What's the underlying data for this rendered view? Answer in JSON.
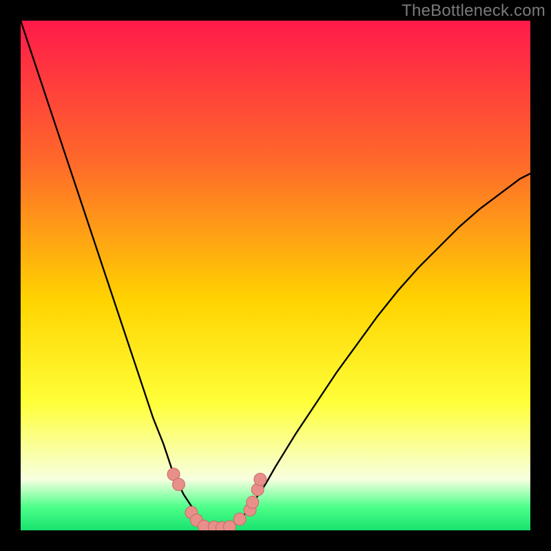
{
  "watermark": "TheBottleneck.com",
  "colors": {
    "bg_black": "#000000",
    "grad_top": "#ff1a4a",
    "grad_mid1": "#ff6a2a",
    "grad_mid2": "#ffd400",
    "grad_yellow": "#ffff3a",
    "grad_pale": "#f7ffe0",
    "grad_green": "#4cff88",
    "grad_green2": "#18e26e",
    "curve": "#000000",
    "marker_fill": "#e88f8a",
    "marker_stroke": "#c86a66"
  },
  "chart_data": {
    "type": "line",
    "title": "",
    "xlabel": "",
    "ylabel": "",
    "xlim": [
      0,
      100
    ],
    "ylim": [
      0,
      100
    ],
    "note": "Bottleneck-style V curve. y≈0 near x≈35–42; rises steeply toward 100 at x→0 and more gently toward ~70 at x→100.",
    "x": [
      0,
      2,
      4,
      6,
      8,
      10,
      12,
      14,
      16,
      18,
      20,
      22,
      24,
      26,
      28,
      30,
      31,
      32,
      33,
      34,
      35,
      36,
      37,
      38,
      39,
      40,
      41,
      42,
      44,
      46,
      48,
      50,
      54,
      58,
      62,
      66,
      70,
      74,
      78,
      82,
      86,
      90,
      94,
      98,
      100
    ],
    "y": [
      100,
      94,
      88,
      82,
      76,
      70,
      64,
      58,
      52,
      46,
      40,
      34,
      28,
      22,
      17,
      11,
      9,
      7,
      5.5,
      4,
      2.5,
      1.5,
      1,
      0.7,
      0.6,
      0.6,
      0.8,
      1.4,
      3.2,
      6,
      9,
      12.5,
      19,
      25,
      31,
      36.5,
      42,
      47,
      51.5,
      55.5,
      59.5,
      63,
      66,
      69,
      70
    ],
    "markers": [
      {
        "x": 30,
        "y": 11
      },
      {
        "x": 31,
        "y": 9
      },
      {
        "x": 33.5,
        "y": 3.5
      },
      {
        "x": 34.5,
        "y": 2
      },
      {
        "x": 36,
        "y": 0.8
      },
      {
        "x": 38,
        "y": 0.6
      },
      {
        "x": 39.5,
        "y": 0.5
      },
      {
        "x": 41,
        "y": 0.7
      },
      {
        "x": 43,
        "y": 2.2
      },
      {
        "x": 45,
        "y": 4
      },
      {
        "x": 45.5,
        "y": 5.5
      },
      {
        "x": 46.5,
        "y": 8
      },
      {
        "x": 47,
        "y": 10
      }
    ]
  }
}
